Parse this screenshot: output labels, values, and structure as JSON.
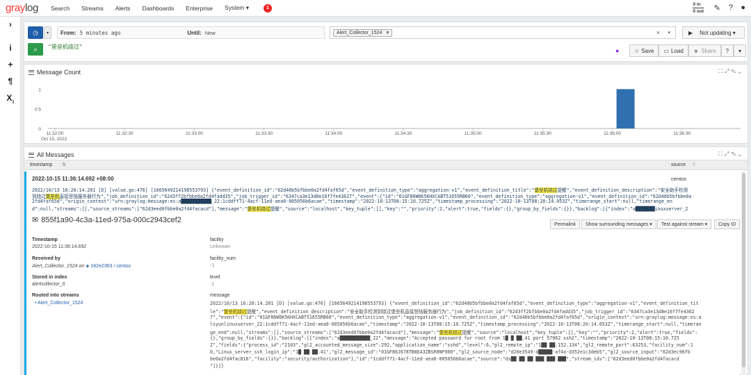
{
  "nav": {
    "logo_g": "gray",
    "logo_rest": "log",
    "items": [
      "Search",
      "Streams",
      "Alerts",
      "Dashboards",
      "Enterprise",
      "System ▾"
    ],
    "notification_count": "1",
    "throughput_in": "0 in",
    "throughput_out": "0 out"
  },
  "sidebar": {
    "icons": [
      "chevron-right-icon",
      "info-icon",
      "plus-icon",
      "paragraph-icon",
      "subscript-icon"
    ]
  },
  "search": {
    "from_label": "From:",
    "from_value": "5 minutes ago",
    "until_label": "Until:",
    "until_value": "Now",
    "stream_chip": "Alert_Collector_1524",
    "refresh": "Not updating ▾",
    "query": "\"堡垒机绕过\"",
    "save": "Save",
    "load": "Load",
    "share": "Share"
  },
  "message_count": {
    "title": "Message Count",
    "chart_data": {
      "type": "bar",
      "x_ticks": [
        "11:32:00",
        "11:32:30",
        "11:33:00",
        "11:33:30",
        "11:34:00",
        "11:34:30",
        "11:35:00",
        "11:35:30",
        "11:36:00",
        "11:36:30"
      ],
      "x_date": "Oct 15, 2022",
      "y_ticks": [
        "1",
        "0.5",
        "0"
      ],
      "ylim": [
        0,
        1.2
      ],
      "bar_color": "#3070b0",
      "bars": [
        {
          "x": "11:36:00",
          "value": 1
        }
      ]
    }
  },
  "all_messages": {
    "title": "All Messages",
    "col_timestamp": "timestamp",
    "col_source": "source",
    "row_timestamp": "2022-10-15 11:36:14.692 +08:00",
    "row_source": "centos",
    "line1_a": "2022/10/13 16:20:14.201 [D] [value.go:476] [1665649214198553793] {\"event_definition_id\":\"62d40b5bfbbe0a2fd4faf65d\",\"event_definition_type\":\"aggregation-v1\",\"event_definition_title\":\"",
    "line1_hl": "堡垒机绕过",
    "line1_b": "提醒\",\"event_definition_description\":\"安全助手检测",
    "line2_a": "到绕过",
    "line2_hl": "堡垒机",
    "line2_b": "直接登陆服务器行为\",\"job_definition_id\":\"62d3ff2bfbbe0a2fd4fadd35\",\"job_trigger_id\":\"6347ca3e13d8e16f7fe43627\",\"event\":{\"id\":\"01GF86W0K5KHXCABT51655RB60\",\"event_definition_type\":\"aggregation-v1\",\"event_definition_id\":\"62d40b5bfbbe0a",
    "line3": "2fd4faf65d\",\"origin_context\":\"urn:graylog:message:es:a███████████_22:1cddff71-4acf-11ed-aea0-005056b6acae\",\"timestamp\":\"2022-10-13T08:15:10.725Z\",\"timestamp_processing\":\"2022-10-13T08:20:14.053Z\",\"timerange_start\":null,\"timerange_en",
    "line4_a": "d\":null,\"streams\":[],\"source_streams\":[\"62d3eed0fbbe0a2fd4facacd\"],\"message\":\"",
    "line4_hl": "堡垒机绕过",
    "line4_b": "提醒\",\"source\":\"localhost\",\"key_tuple\":[],\"key\":\"\",\"priority\":2,\"alert\":true,\"fields\":{},\"group_by_fields\":{}},\"backlog\":[{\"index\":\"a███████inuxserver_2",
    "message_id": "855f1a90-4c3a-11ed-975a-000c2943cef2",
    "actions": [
      "Permalink",
      "Show surrounding messages ▾",
      "Test against stream ▾",
      "Copy ID"
    ],
    "fields": {
      "timestamp_label": "Timestamp",
      "timestamp_value": "2022-10-15 11:36:14.692",
      "received_label": "Received by",
      "received_value": "Alert_Collector_1524 on",
      "received_node": "182e2363 / centos",
      "stored_label": "Stored in index",
      "stored_value": "alertcollector_0",
      "routed_label": "Routed into streams",
      "routed_value": "Alert_Collector_1524",
      "facility_label": "facility",
      "facility_value": "Unknown",
      "facility_num_label": "facility_num",
      "facility_num_value": "-1",
      "level_label": "level",
      "level_value": "-1",
      "message_label": "message"
    },
    "message_lines": [
      "2022/10/13 16:20:14.201 [D] [value.go:476]  [1665649214198553793] {\"event_definition_id\":\"62d40b5bfbbe0a2fd4faf65d\",\"event_definition_type\":\"aggregation-v1\",\"event_definition_tit",
      "le\":\"",
      "7\",\"event\":{\"id\":\"01GF86W0K5KHXCABT51655RB60\",\"event_definition_type\":\"aggregation-v1\",\"event_definition_id\":\"62d40b5bfbbe0a2fd4faf65d\",\"origin_context\":\"urn:graylog:message:es:a",
      "lsyunlinuxserver_22:1cddff71-4acf-11ed-aea0-005056b6acae\",\"timestamp\":\"2022-10-13T08:15:10.725Z\",\"timestamp_processing\":\"2022-10-13T08:20:14.053Z\",\"timerange_start\":null,\"timeran",
      "ge_end\":null,\"streams\":[],\"source_streams\":[\"62d3eed0fbbe0a2fd4facacd\"],\"message\":\"",
      "{},\"group_by_fields\":{}},\"backlog\":[{\"index\":\"a███████████_22\",\"message\":\"Accepted password for root from  1█ █ ██.41 port 57062 ssh2\",\"timestamp\":\"2022-10-13T08:15:10.725",
      "Z\",\"fields\":{\"process_id\":\"2103\",\"gl2_accounted_message_size\":292,\"application_name\":\"sshd\",\"level\":6,\"gl2_remote_ip\":\"1██ ██.152.134\",\"gl2_remote_port\":63253,\"facility_num\":1",
      "0,\"Linux_server_ssh_login_ip\":\"1█ ██ ██.41\",\"gl2_message_id\":\"01GF86J678TB8EA3ZBSR0NF900\",\"gl2_source_node\":\"d20e3549-d█████-af4a-d352e1c3deb5\",\"gl2_source_input\":\"62d3ec96fb",
      "be0a2fd4fac816\",\"facility\":\"security/authorization\"},\"id\":\"1cddff71-4acf-11ed-aea0-005056b6acae\",\"source\":\"ds██ ██ ██ ███ ███ ███\",\"stream_ids\":[\"62d3eed0fbbe0a2fd4facacd",
      "\"]}]}"
    ],
    "msg_hl": "堡垒机绕过",
    "msg_line2_rest": "提醒\",\"event_definition_description\":\"安全助手检测到绕过堡垒机直接登陆服务器行为\",\"job_definition_id\":\"62d3ff2bfbbe0a2fd4fadd35\",\"job_trigger_id\":\"6347ca3e13d8e16f7fe4362",
    "msg_line5_rest": "提醒\",\"source\":\"localhost\",\"key_tuple\":[],\"key\":\"\",\"priority\":2,\"alert\":true,\"fields\":"
  }
}
